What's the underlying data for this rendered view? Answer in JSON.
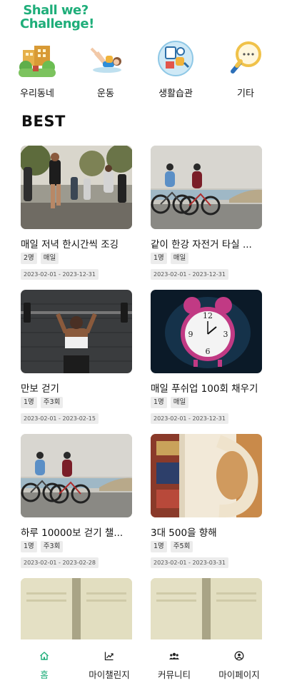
{
  "app": {
    "logo_line1": "Shall we?",
    "logo_line2": "Challenge!",
    "brand_color": "#1fae7a"
  },
  "categories": [
    {
      "label": "우리동네",
      "icon": "neighborhood-icon"
    },
    {
      "label": "운동",
      "icon": "exercise-icon"
    },
    {
      "label": "생활습관",
      "icon": "lifestyle-icon"
    },
    {
      "label": "기타",
      "icon": "more-search-icon"
    }
  ],
  "section": {
    "best_title": "BEST"
  },
  "challenges": [
    {
      "title": "매일 저녁 한시간씩 조깅",
      "people": "2명",
      "frequency": "매일",
      "period": "2023-02-01 - 2023-12-31",
      "image": "running-group-photo"
    },
    {
      "title": "같이 한강 자전거 타실 ...",
      "people": "1명",
      "frequency": "매일",
      "period": "2023-02-01 - 2023-12-31",
      "image": "cyclists-photo"
    },
    {
      "title": "만보 걷기",
      "people": "1명",
      "frequency": "주3회",
      "period": "2023-02-01 - 2023-02-15",
      "image": "weightlifting-photo"
    },
    {
      "title": "매일 푸쉬업 100회 채우기",
      "people": "1명",
      "frequency": "매일",
      "period": "2023-02-01 - 2023-12-31",
      "image": "alarm-clock-photo"
    },
    {
      "title": "하루 10000보 걷기 챌...",
      "people": "1명",
      "frequency": "주3회",
      "period": "2023-02-01 - 2023-02-28",
      "image": "cyclists-photo"
    },
    {
      "title": "3대 500을 향해",
      "people": "1명",
      "frequency": "주5회",
      "period": "2023-02-01 - 2023-03-31",
      "image": "coffee-mug-photo"
    },
    {
      "title": "",
      "people": "",
      "frequency": "",
      "period": "",
      "image": "open-book-photo"
    },
    {
      "title": "",
      "people": "",
      "frequency": "",
      "period": "",
      "image": "open-book-photo"
    }
  ],
  "tabbar": [
    {
      "label": "홈",
      "icon": "home-icon",
      "active": true
    },
    {
      "label": "마이챌린지",
      "icon": "chart-trend-icon",
      "active": false
    },
    {
      "label": "커뮤니티",
      "icon": "people-icon",
      "active": false
    },
    {
      "label": "마이페이지",
      "icon": "user-circle-icon",
      "active": false
    }
  ]
}
